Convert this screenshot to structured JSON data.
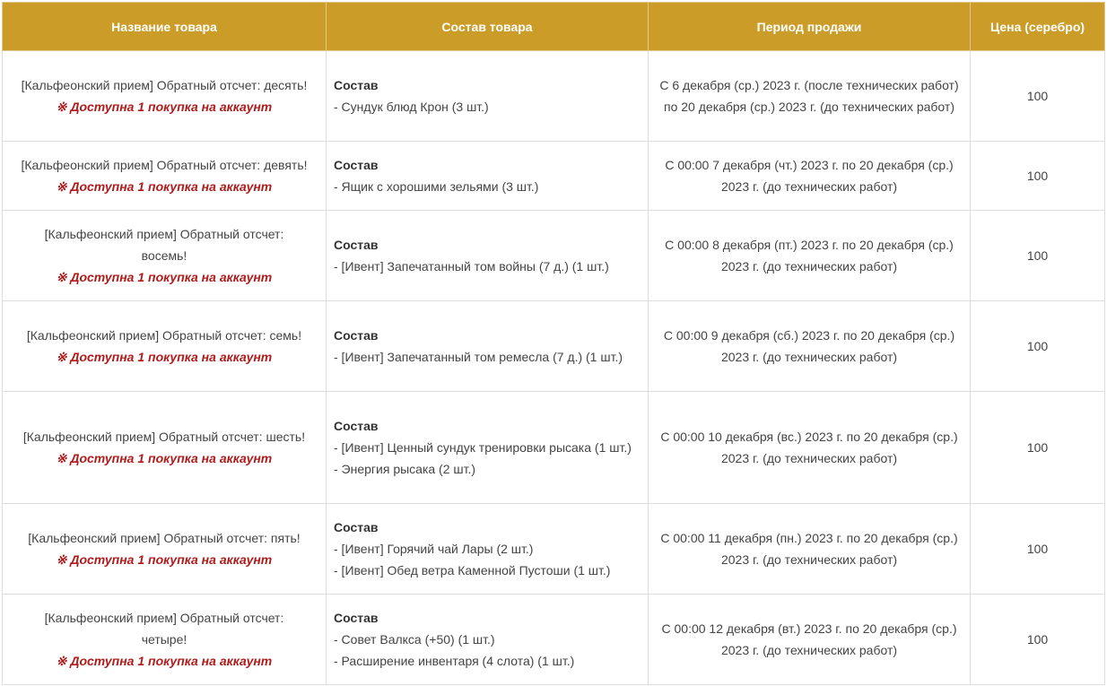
{
  "table": {
    "headers": [
      "Название товара",
      "Состав товара",
      "Период продажи",
      "Цена (серебро)"
    ],
    "contents_heading": "Состав",
    "limit_text": "※ Доступна 1 покупка на аккаунт",
    "rows": [
      {
        "name": "[Кальфеонский прием] Обратный отсчет: десять!",
        "items": [
          "- Сундук блюд Крон (3 шт.)"
        ],
        "period": "С 6 декабря (ср.) 2023 г. (после технических работ) по 20 декабря (ср.) 2023 г. (до технических работ)",
        "price": "100"
      },
      {
        "name": "[Кальфеонский прием] Обратный отсчет: девять!",
        "items": [
          "- Ящик с хорошими зельями (3 шт.)"
        ],
        "period": "С 00:00 7 декабря (чт.) 2023 г. по 20 декабря (ср.) 2023 г. (до технических работ)",
        "price": "100"
      },
      {
        "name": "[Кальфеонский прием] Обратный отсчет: восемь!",
        "items": [
          "- [Ивент] Запечатанный том войны (7 д.) (1 шт.)"
        ],
        "period": "С 00:00 8 декабря (пт.) 2023 г. по 20 декабря (ср.) 2023 г. (до технических работ)",
        "price": "100"
      },
      {
        "name": "[Кальфеонский прием] Обратный отсчет: семь!",
        "items": [
          "- [Ивент] Запечатанный том ремесла (7 д.) (1 шт.)"
        ],
        "period": "С 00:00 9 декабря (сб.) 2023 г. по 20 декабря (ср.) 2023 г. (до технических работ)",
        "price": "100"
      },
      {
        "name": "[Кальфеонский прием] Обратный отсчет: шесть!",
        "items": [
          "- [Ивент] Ценный сундук тренировки рысака (1 шт.)",
          "- Энергия рысака (2 шт.)"
        ],
        "period": "С 00:00 10 декабря (вс.) 2023 г. по 20 декабря (ср.) 2023 г. (до технических работ)",
        "price": "100"
      },
      {
        "name": "[Кальфеонский прием] Обратный отсчет: пять!",
        "items": [
          "- [Ивент] Горячий чай Лары (2 шт.)",
          "- [Ивент] Обед ветра Каменной Пустоши (1 шт.)"
        ],
        "period": "С 00:00 11 декабря (пн.) 2023 г. по 20 декабря (ср.) 2023 г. (до технических работ)",
        "price": "100"
      },
      {
        "name": "[Кальфеонский прием] Обратный отсчет: четыре!",
        "items": [
          "- Совет Валкса (+50) (1 шт.)",
          "- Расширение инвентаря (4 слота) (1 шт.)"
        ],
        "period": "С 00:00 12 декабря (вт.) 2023 г. по 20 декабря (ср.) 2023 г. (до технических работ)",
        "price": "100"
      }
    ]
  },
  "colors": {
    "header_bg": "#cc9c28",
    "header_text": "#ffffff",
    "limit_text": "#b01b1b",
    "border": "#dddddd"
  }
}
